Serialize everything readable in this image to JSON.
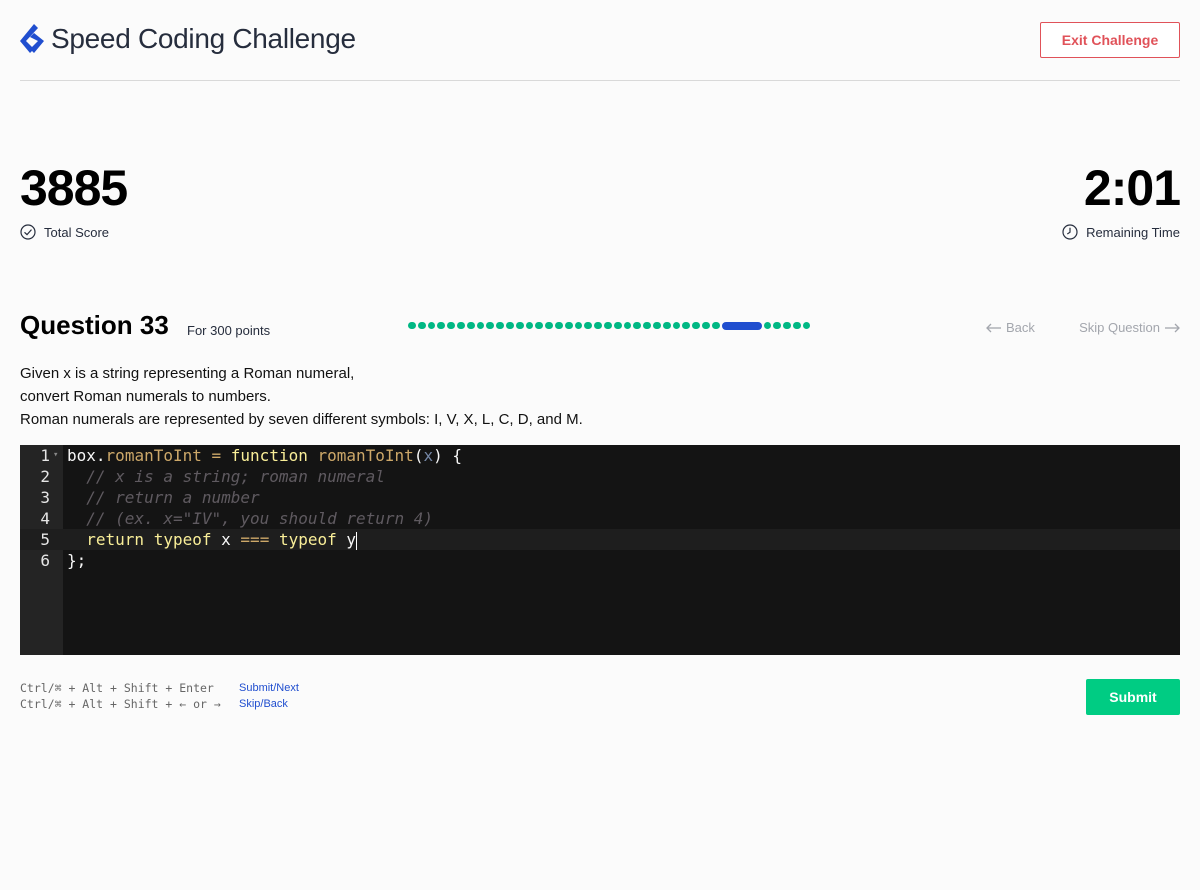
{
  "header": {
    "title": "Speed Coding Challenge",
    "exit_label": "Exit Challenge"
  },
  "stats": {
    "score": "3885",
    "score_label": "Total Score",
    "time": "2:01",
    "time_label": "Remaining Time"
  },
  "question": {
    "title": "Question 33",
    "points": "For 300 points",
    "progress": {
      "total": 38,
      "current": 33
    },
    "back_label": "Back",
    "skip_label": "Skip Question",
    "description": [
      "Given x is a string representing a Roman numeral,",
      "convert Roman numerals to numbers.",
      "Roman numerals are represented by seven different symbols: I, V, X, L, C, D, and M."
    ]
  },
  "editor": {
    "line_numbers": [
      "1",
      "2",
      "3",
      "4",
      "5",
      "6"
    ],
    "tokens": {
      "box": "box",
      "dot": ".",
      "fn_name": "romanToInt",
      "eq": " = ",
      "function_kw": "function",
      "space": " ",
      "open_paren": "(",
      "param": "x",
      "close_paren_brace": ") {",
      "comment1": "  // x is a string; roman numeral",
      "comment2": "  // return a number",
      "comment3": "  // (ex. x=\"IV\", you should return 4)",
      "indent": "  ",
      "return_kw": "return",
      "typeof_kw": "typeof",
      "x_var": "x",
      "strict_eq": "===",
      "y_var": "y",
      "closing": "};"
    },
    "colors": {
      "background": "#141414",
      "gutter": "#242424",
      "keyword": "#f9ee98",
      "function": "#cda869",
      "comment": "#5f5a60"
    }
  },
  "shortcuts": [
    {
      "keys": "Ctrl/⌘ + Alt + Shift + Enter",
      "action": "Submit/Next"
    },
    {
      "keys": "Ctrl/⌘ + Alt + Shift + ← or →",
      "action": "Skip/Back"
    }
  ],
  "submit_label": "Submit",
  "colors": {
    "accent": "#204ecf",
    "success": "#00cc83",
    "danger": "#e05259",
    "progress_done": "#00b884"
  }
}
